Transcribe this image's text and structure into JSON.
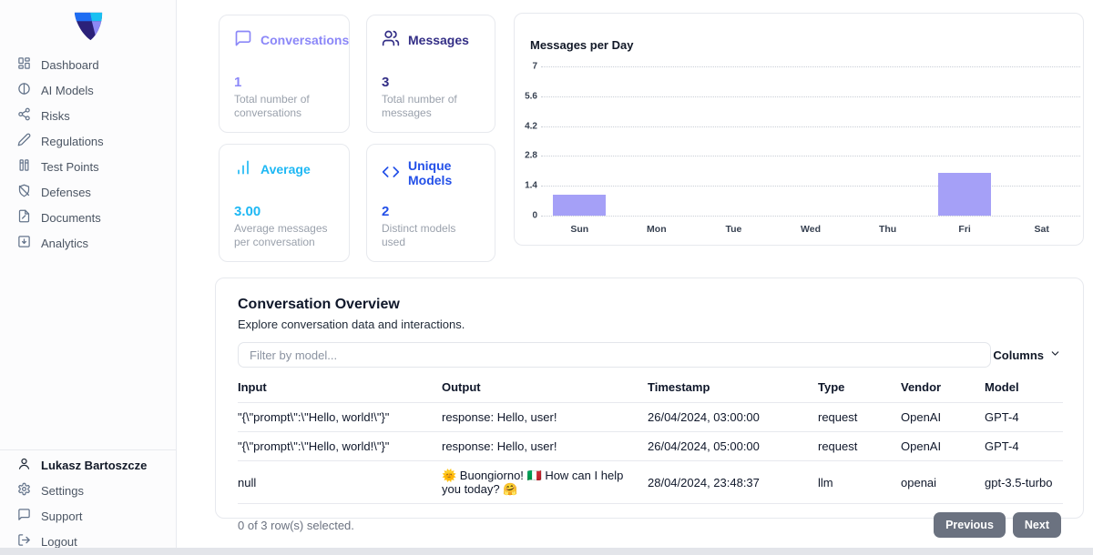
{
  "sidebar": {
    "nav": [
      {
        "label": "Dashboard",
        "icon": "dashboard-icon"
      },
      {
        "label": "AI Models",
        "icon": "ai-models-icon"
      },
      {
        "label": "Risks",
        "icon": "risks-icon"
      },
      {
        "label": "Regulations",
        "icon": "pen-icon"
      },
      {
        "label": "Test Points",
        "icon": "test-points-icon"
      },
      {
        "label": "Defenses",
        "icon": "shield-off-icon"
      },
      {
        "label": "Documents",
        "icon": "file-icon"
      },
      {
        "label": "Analytics",
        "icon": "analytics-icon"
      }
    ],
    "footer": [
      {
        "label": "Lukasz Bartoszcze",
        "icon": "user-icon"
      },
      {
        "label": "Settings",
        "icon": "gear-icon"
      },
      {
        "label": "Support",
        "icon": "message-square-icon"
      },
      {
        "label": "Logout",
        "icon": "logout-icon"
      }
    ]
  },
  "stats": [
    {
      "title": "Conversations",
      "value": "1",
      "subtitle": "Total number of conversations",
      "color": "#8b87f8",
      "icon": "message-square-icon"
    },
    {
      "title": "Messages",
      "value": "3",
      "subtitle": "Total number of messages",
      "color": "#332e86",
      "icon": "users-icon"
    },
    {
      "title": "Average",
      "value": "3.00",
      "subtitle": "Average messages per conversation",
      "color": "#1eb8f4",
      "icon": "bar-chart-icon"
    },
    {
      "title": "Unique Models",
      "value": "2",
      "subtitle": "Distinct models used",
      "color": "#2350e8",
      "icon": "code-icon"
    }
  ],
  "chart_data": {
    "type": "bar",
    "title": "Messages per Day",
    "categories": [
      "Sun",
      "Mon",
      "Tue",
      "Wed",
      "Thu",
      "Fri",
      "Sat"
    ],
    "values": [
      1,
      0,
      0,
      0,
      0,
      2,
      0
    ],
    "yticks": [
      0,
      1.4,
      2.8,
      4.2,
      5.6,
      7
    ],
    "ylim": [
      0,
      7
    ],
    "xlabel": "",
    "ylabel": "",
    "grid": "horizontal-dotted",
    "legend": "none",
    "bar_color": "#a5a0f7"
  },
  "table": {
    "title": "Conversation Overview",
    "subtitle": "Explore conversation data and interactions.",
    "filter_placeholder": "Filter by model...",
    "filter_value": "",
    "columns_button": "Columns",
    "headers": [
      "Input",
      "Output",
      "Timestamp",
      "Type",
      "Vendor",
      "Model"
    ],
    "rows": [
      [
        "\"{\\\"prompt\\\":\\\"Hello, world!\\\"}\"",
        "response: Hello, user!",
        "26/04/2024, 03:00:00",
        "request",
        "OpenAI",
        "GPT-4"
      ],
      [
        "\"{\\\"prompt\\\":\\\"Hello, world!\\\"}\"",
        "response: Hello, user!",
        "26/04/2024, 05:00:00",
        "request",
        "OpenAI",
        "GPT-4"
      ],
      [
        "null",
        "🌞 Buongiorno! 🇮🇹 How can I help you today? 🤗",
        "28/04/2024, 23:48:37",
        "llm",
        "openai",
        "gpt-3.5-turbo"
      ]
    ],
    "footer_status": "0 of 3 row(s) selected.",
    "prev_label": "Previous",
    "next_label": "Next"
  }
}
